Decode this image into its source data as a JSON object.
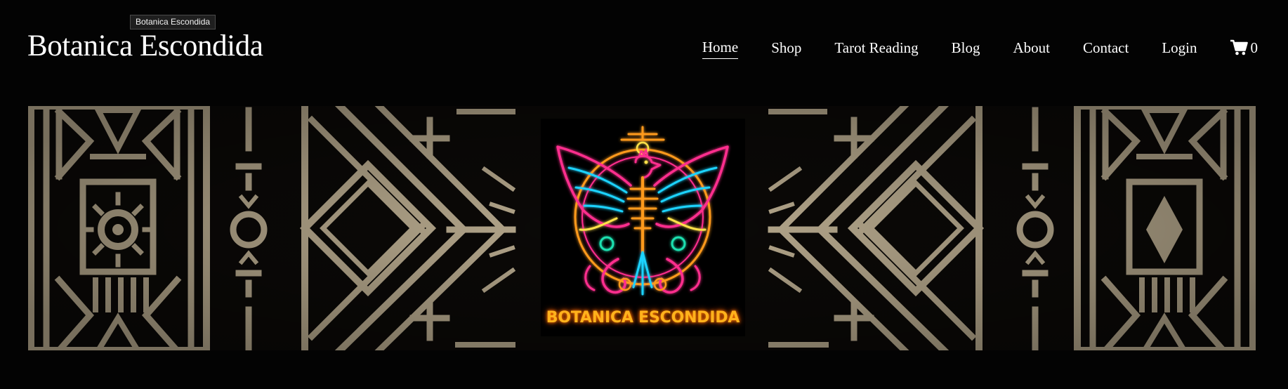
{
  "tooltip": {
    "label": "Botanica Escondida"
  },
  "site": {
    "title": "Botanica Escondida"
  },
  "nav": {
    "items": [
      {
        "label": "Home",
        "active": true
      },
      {
        "label": "Shop",
        "active": false
      },
      {
        "label": "Tarot Reading",
        "active": false
      },
      {
        "label": "Blog",
        "active": false
      },
      {
        "label": "About",
        "active": false
      },
      {
        "label": "Contact",
        "active": false
      },
      {
        "label": "Login",
        "active": false
      }
    ]
  },
  "cart": {
    "icon": "cart-icon",
    "count": "0"
  },
  "banner": {
    "logo_text": "BOTANICA ESCONDIDA",
    "pattern_color": "#b9ab8f",
    "neon_colors": [
      "#ff2f8e",
      "#ff9a1f",
      "#1fd3ff",
      "#ffe14a",
      "#1fe0b0"
    ]
  },
  "colors": {
    "background": "#030303",
    "text": "#ffffff",
    "logo_text": "#ffb21c"
  }
}
